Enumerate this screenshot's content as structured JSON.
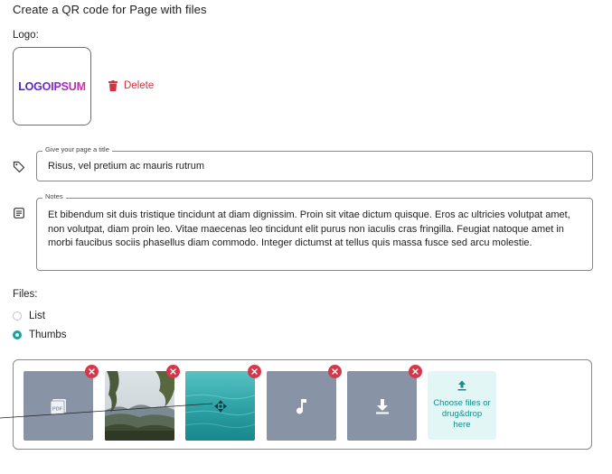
{
  "page": {
    "title": "Create a QR code for Page with files"
  },
  "logo": {
    "label": "Logo:",
    "image_text": "LOGOIPSUM",
    "delete_label": "Delete"
  },
  "title_field": {
    "legend": "Give your page a title",
    "value": "Risus, vel pretium ac mauris rutrum",
    "icon": "tag-icon"
  },
  "notes_field": {
    "legend": "Notes",
    "value": "Et bibendum sit duis tristique tincidunt at diam dignissim. Proin sit vitae dictum quisque. Eros ac ultricies volutpat amet, non volutpat, diam proin leo. Vitae maecenas leo tincidunt elit purus non iaculis cras fringilla. Feugiat natoque amet in morbi faucibus sociis phasellus diam commodo. Integer dictumst at tellus quis massa fusce sed arcu molestie.",
    "icon": "notes-icon"
  },
  "files": {
    "label": "Files:",
    "view_options": [
      {
        "label": "List",
        "selected": false
      },
      {
        "label": "Thumbs",
        "selected": true
      }
    ],
    "items": [
      {
        "type": "pdf",
        "icon_text": "PDF"
      },
      {
        "type": "image-landscape"
      },
      {
        "type": "image-water"
      },
      {
        "type": "audio",
        "icon": "music-note-icon"
      },
      {
        "type": "download",
        "icon": "download-icon"
      }
    ],
    "upload_label": "Choose files or drug&drop here"
  },
  "colors": {
    "accent": "#17a2a2",
    "danger": "#d3374a",
    "file_tile": "#8893a5",
    "upload_bg": "#e2f6f5"
  }
}
